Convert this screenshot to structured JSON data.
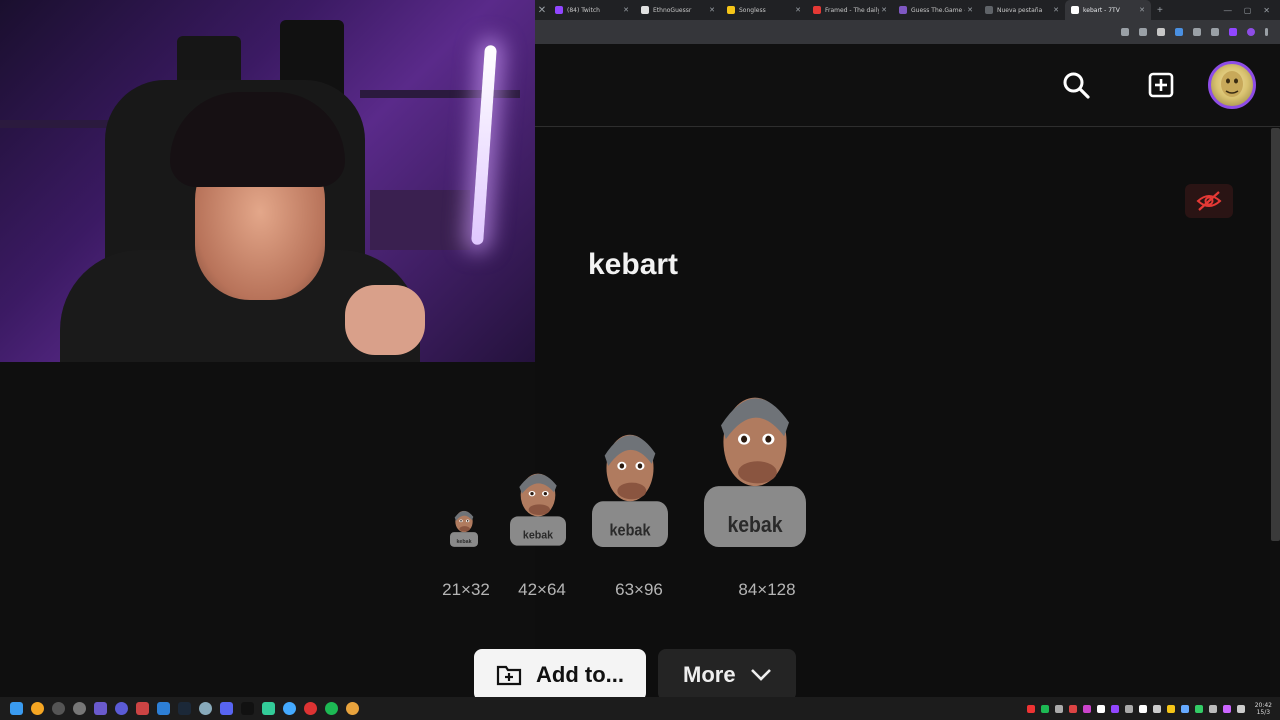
{
  "browser": {
    "tabs": [
      {
        "label": "(84) Twitch",
        "color": "#9146ff"
      },
      {
        "label": "EthnoGuessr",
        "color": "#e0e0e0"
      },
      {
        "label": "Songless",
        "color": "#f5c518"
      },
      {
        "label": "Framed - The daily",
        "color": "#e53935"
      },
      {
        "label": "Guess The.Game #",
        "color": "#7e57c2"
      },
      {
        "label": "Nueva pestaña",
        "color": "#5f6368"
      },
      {
        "label": "kebart - 7TV",
        "color": "#ffffff",
        "active": true
      }
    ]
  },
  "header": {
    "search_icon": "search-icon",
    "add_icon": "plus-square-icon",
    "avatar_icon": "user-avatar"
  },
  "emote": {
    "name": "kebart",
    "shirt_text": "kebak",
    "hidden_icon": "eye-off-icon",
    "accent": "#e53935",
    "sizes": [
      "21×32",
      "42×64",
      "63×96",
      "84×128"
    ]
  },
  "actions": {
    "add_label": "Add to...",
    "more_label": "More"
  },
  "taskbar": {
    "time": "20:42",
    "date": "15/3"
  }
}
